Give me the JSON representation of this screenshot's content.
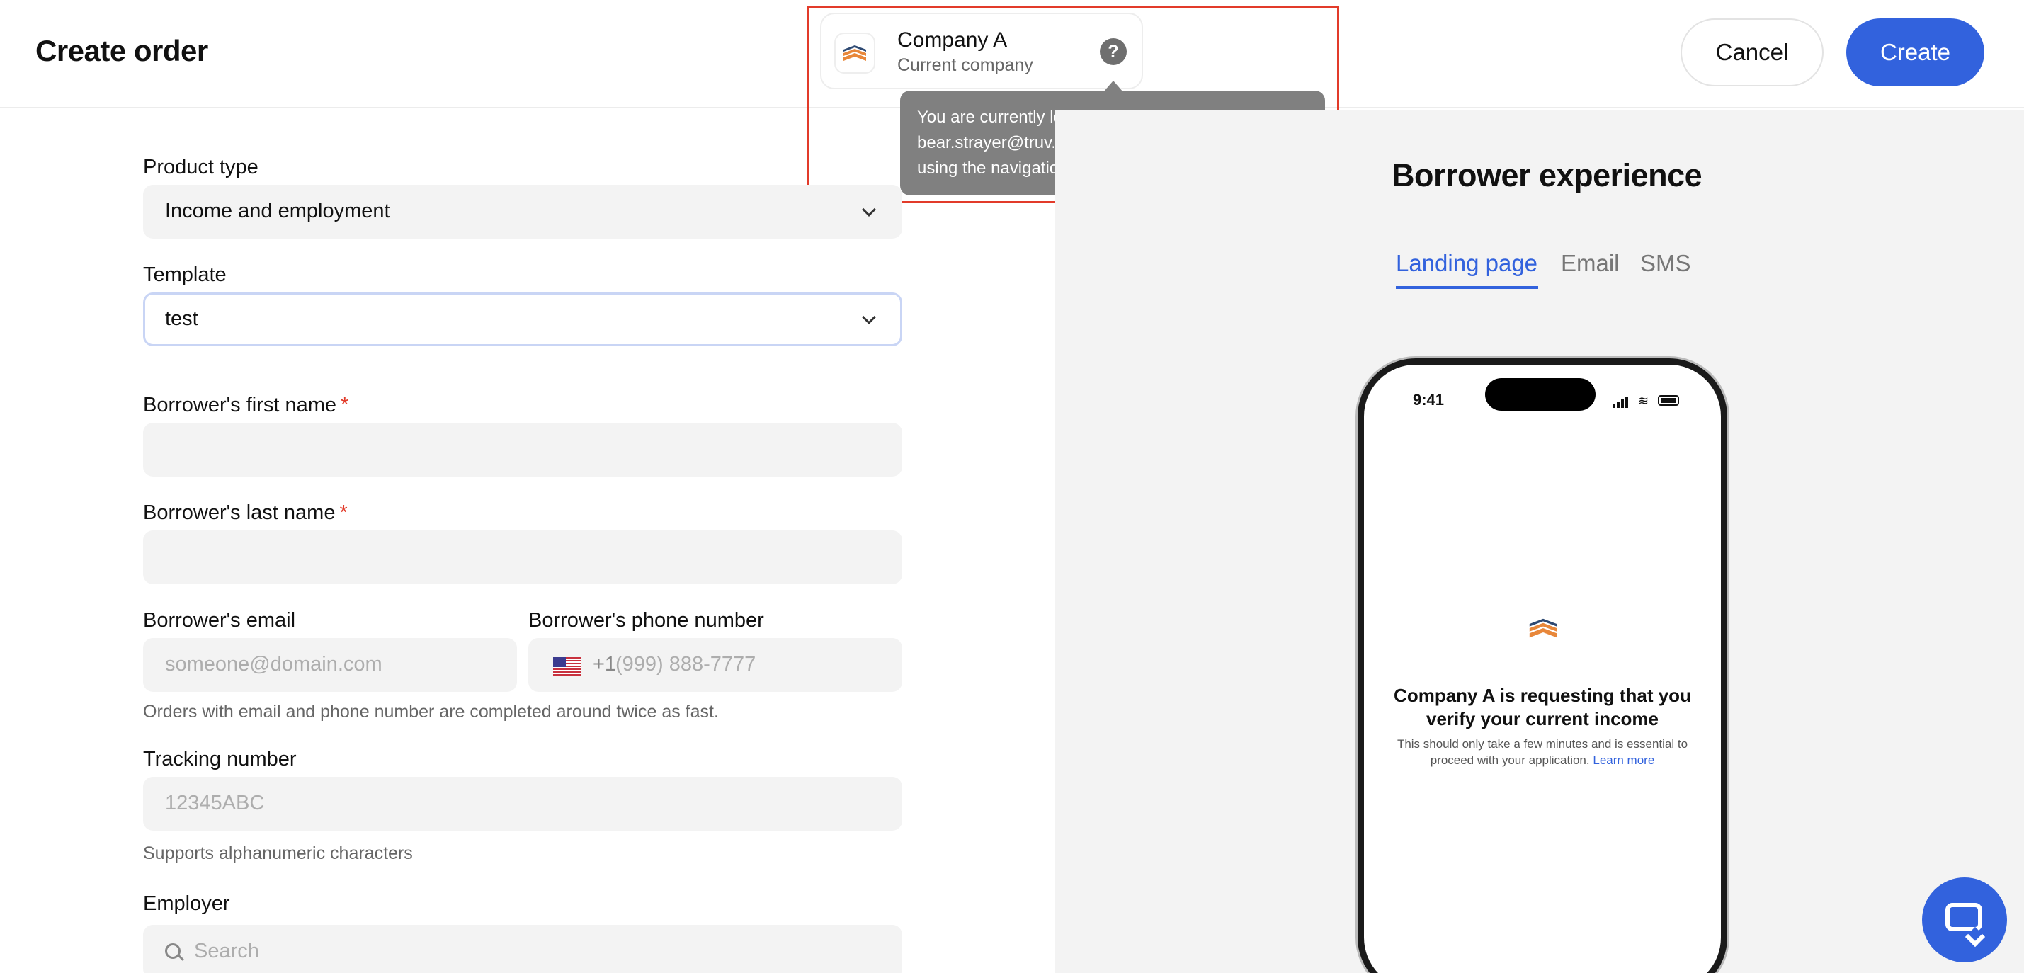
{
  "header": {
    "title": "Create order",
    "cancel_label": "Cancel",
    "create_label": "Create"
  },
  "company": {
    "name": "Company A",
    "subtitle": "Current company",
    "help_glyph": "?",
    "tooltip": "You are currently logged into Company A (Owner: bear.strayer@truv.com). You can switch companies using the navigation menu."
  },
  "form": {
    "product_type": {
      "label": "Product type",
      "value": "Income and employment"
    },
    "template": {
      "label": "Template",
      "value": "test"
    },
    "first_name": {
      "label": "Borrower's first name",
      "required_mark": "*",
      "value": ""
    },
    "last_name": {
      "label": "Borrower's last name",
      "required_mark": "*",
      "value": ""
    },
    "email": {
      "label": "Borrower's email",
      "placeholder": "someone@domain.com"
    },
    "phone": {
      "label": "Borrower's phone number",
      "country_code": "+1",
      "placeholder": "(999) 888-7777"
    },
    "contact_helper": "Orders with email and phone number are completed around twice as fast.",
    "tracking": {
      "label": "Tracking number",
      "placeholder": "12345ABC",
      "helper": "Supports alphanumeric characters"
    },
    "employer": {
      "label": "Employer",
      "placeholder": "Search"
    }
  },
  "preview": {
    "title": "Borrower experience",
    "tabs": [
      "Landing page",
      "Email",
      "SMS"
    ],
    "active_tab": "Landing page",
    "phone": {
      "time": "9:41",
      "heading": "Company A is requesting that you verify your current income",
      "body": "This should only take a few minutes and is essential to proceed with your application.",
      "link": "Learn more"
    }
  },
  "colors": {
    "accent": "#3262dd",
    "highlight_border": "#e23b2a",
    "tooltip_bg": "#808080",
    "logo_orange": "#e8873a"
  },
  "icons": [
    "company-logo-icon",
    "help-icon",
    "chevron-down-icon",
    "us-flag-icon",
    "search-icon",
    "chat-icon"
  ]
}
